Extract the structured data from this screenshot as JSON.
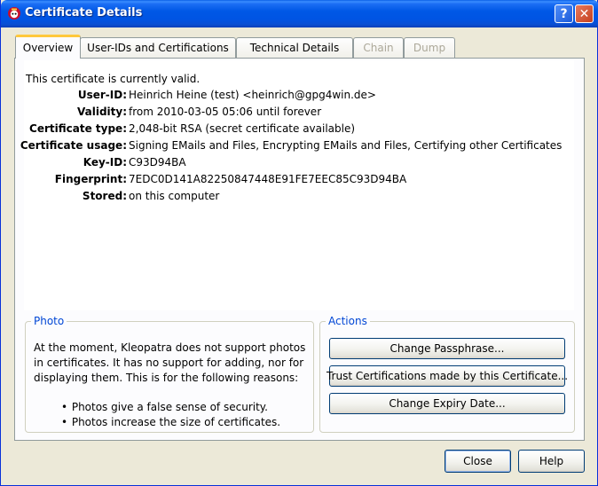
{
  "window": {
    "title": "Certificate Details"
  },
  "tabs": [
    {
      "label": "Overview",
      "active": true,
      "disabled": false
    },
    {
      "label": "User-IDs and Certifications",
      "active": false,
      "disabled": false
    },
    {
      "label": "Technical Details",
      "active": false,
      "disabled": false
    },
    {
      "label": "Chain",
      "active": false,
      "disabled": true
    },
    {
      "label": "Dump",
      "active": false,
      "disabled": true
    }
  ],
  "overview": {
    "valid_text": "This certificate is currently valid.",
    "rows": [
      {
        "label": "User-ID:",
        "value": "Heinrich Heine (test) <heinrich@gpg4win.de>"
      },
      {
        "label": "Validity:",
        "value": "from 2010-03-05 05:06 until forever"
      },
      {
        "label": "Certificate type:",
        "value": "2,048-bit RSA (secret certificate available)"
      },
      {
        "label": "Certificate usage:",
        "value": "Signing EMails and Files, Encrypting EMails and Files, Certifying other Certificates"
      },
      {
        "label": "Key-ID:",
        "value": "C93D94BA"
      },
      {
        "label": "Fingerprint:",
        "value": "7EDC0D141A82250847448E91FE7EEC85C93D94BA"
      },
      {
        "label": "Stored:",
        "value": "on this computer"
      }
    ]
  },
  "photo": {
    "title": "Photo",
    "line1": "At the moment, Kleopatra does not support photos",
    "line2": "in certificates. It has no support for adding, nor for",
    "line3": "displaying them. This is for the following reasons:",
    "bullet1": "Photos give a false sense of security.",
    "bullet2": "Photos increase the size of certificates."
  },
  "actions": {
    "title": "Actions",
    "change_passphrase": "Change Passphrase...",
    "trust_certifications": "Trust Certifications made by this Certificate...",
    "change_expiry": "Change Expiry Date..."
  },
  "footer": {
    "close": "Close",
    "help": "Help"
  },
  "titlebar": {
    "help_glyph": "?",
    "close_glyph": "✕"
  },
  "colors": {
    "titlebar": "#0054e3",
    "group_title": "#0046d5",
    "tab_highlight": "#ffc83c"
  }
}
